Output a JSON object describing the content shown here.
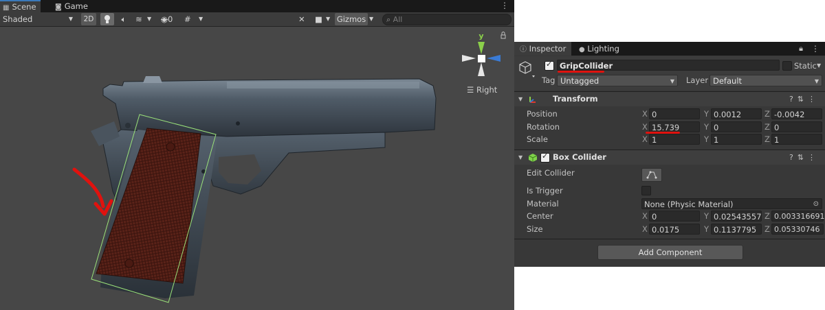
{
  "scene": {
    "tabs": [
      {
        "label": "Scene",
        "active": true
      },
      {
        "label": "Game",
        "active": false
      }
    ],
    "toolbar": {
      "shading_mode": "Shaded",
      "toggle_2d": "2D",
      "hidden_count": "0",
      "gizmos_label": "Gizmos",
      "search_placeholder": "All"
    },
    "orientation_gizmo": {
      "axis_label": "y",
      "view_label": "Right"
    },
    "colors": {
      "x_axis": "#e03a2f",
      "y_axis": "#8bd04a",
      "z_axis": "#3a7bd5",
      "collider_outline": "#9be37a",
      "annotation": "#e0120e"
    },
    "annotation": {
      "type": "curved-arrow",
      "pointing_to": "grip-collider"
    }
  },
  "inspector": {
    "tabs": [
      {
        "label": "Inspector",
        "active": true
      },
      {
        "label": "Lighting",
        "active": false
      }
    ],
    "object": {
      "active": true,
      "name": "GripCollider",
      "static_label": "Static",
      "tag_label": "Tag",
      "tag_value": "Untagged",
      "layer_label": "Layer",
      "layer_value": "Default"
    },
    "transform": {
      "title": "Transform",
      "position": {
        "label": "Position",
        "x": "0",
        "y": "0.0012",
        "z": "-0.0042"
      },
      "rotation": {
        "label": "Rotation",
        "x": "15.739",
        "y": "0",
        "z": "0"
      },
      "scale": {
        "label": "Scale",
        "x": "1",
        "y": "1",
        "z": "1"
      }
    },
    "box_collider": {
      "title": "Box Collider",
      "enabled": true,
      "edit_collider_label": "Edit Collider",
      "is_trigger_label": "Is Trigger",
      "material_label": "Material",
      "material_value": "None (Physic Material)",
      "center": {
        "label": "Center",
        "x": "0",
        "y": "0.02543557",
        "z": "0.003316691"
      },
      "size": {
        "label": "Size",
        "x": "0.0175",
        "y": "0.1137795",
        "z": "0.05330746"
      }
    },
    "add_component_label": "Add Component",
    "axis_letters": {
      "x": "X",
      "y": "Y",
      "z": "Z"
    }
  }
}
